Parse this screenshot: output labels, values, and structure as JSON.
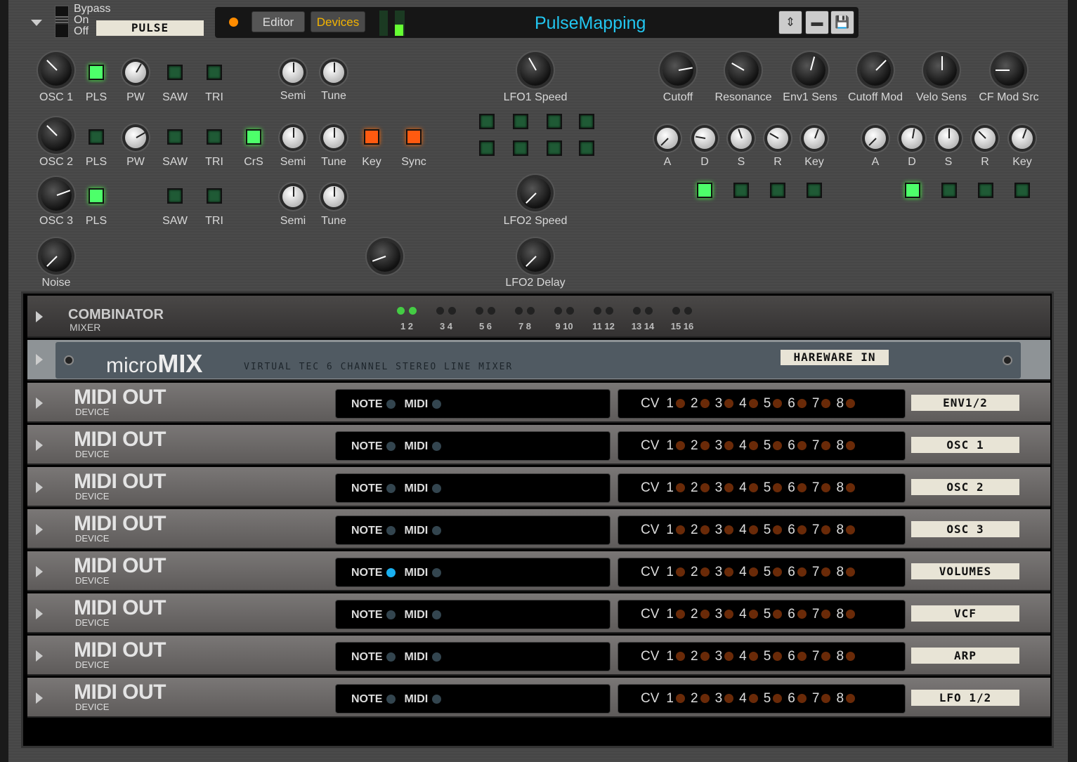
{
  "header": {
    "bypass": "Bypass",
    "on": "On",
    "off": "Off",
    "patch_name": "PULSE",
    "editor": "Editor",
    "devices": "Devices",
    "title": "PulseMapping"
  },
  "colors": {
    "accent_title": "#22c6f0",
    "devices_text": "#f4b400",
    "led_green": "#4dff6a",
    "led_orange": "#ff5a10"
  },
  "knobs": [
    {
      "label": "OSC 1",
      "style": "dark",
      "angle": -45
    },
    {
      "label": "PW",
      "style": "light",
      "angle": 30
    },
    {
      "label": "Semi",
      "style": "light",
      "angle": 0
    },
    {
      "label": "Tune",
      "style": "light",
      "angle": 0
    },
    {
      "label": "LFO1 Speed",
      "style": "dark",
      "angle": -30
    },
    {
      "label": "Cutoff",
      "style": "dark",
      "angle": 80
    },
    {
      "label": "Resonance",
      "style": "dark",
      "angle": -60
    },
    {
      "label": "Env1 Sens",
      "style": "dark",
      "angle": 15
    },
    {
      "label": "Cutoff Mod",
      "style": "dark",
      "angle": 45
    },
    {
      "label": "Velo Sens",
      "style": "dark",
      "angle": 0
    },
    {
      "label": "CF Mod Src",
      "style": "dark",
      "angle": -90
    },
    {
      "label": "OSC 2",
      "style": "dark",
      "angle": -45
    },
    {
      "label": "PW",
      "style": "light",
      "angle": 60
    },
    {
      "label": "Semi",
      "style": "light",
      "angle": 0
    },
    {
      "label": "Tune",
      "style": "light",
      "angle": 0
    },
    {
      "label": "A",
      "style": "light",
      "angle": -135
    },
    {
      "label": "D",
      "style": "light",
      "angle": -80
    },
    {
      "label": "S",
      "style": "light",
      "angle": -20
    },
    {
      "label": "R",
      "style": "light",
      "angle": -60
    },
    {
      "label": "Key",
      "style": "light",
      "angle": 20
    },
    {
      "label": "A",
      "style": "light",
      "angle": -135
    },
    {
      "label": "D",
      "style": "light",
      "angle": 10
    },
    {
      "label": "S",
      "style": "light",
      "angle": 0
    },
    {
      "label": "R",
      "style": "light",
      "angle": -45
    },
    {
      "label": "Key",
      "style": "light",
      "angle": 20
    },
    {
      "label": "OSC 3",
      "style": "dark",
      "angle": 70
    },
    {
      "label": "Semi",
      "style": "light",
      "angle": 0
    },
    {
      "label": "Tune",
      "style": "light",
      "angle": 0
    },
    {
      "label": "LFO2 Speed",
      "style": "dark",
      "angle": -135
    },
    {
      "label": "Noise",
      "style": "dark",
      "angle": -135
    },
    {
      "label": "",
      "style": "dark",
      "angle": -110
    },
    {
      "label": "LFO2 Delay",
      "style": "dark",
      "angle": -135
    }
  ],
  "buttons": [
    {
      "label": "PLS",
      "state": "on"
    },
    {
      "label": "SAW",
      "state": "off"
    },
    {
      "label": "TRI",
      "state": "off"
    },
    {
      "label": "PLS",
      "state": "off"
    },
    {
      "label": "SAW",
      "state": "off"
    },
    {
      "label": "TRI",
      "state": "off"
    },
    {
      "label": "CrS",
      "state": "on"
    },
    {
      "label": "Key",
      "state": "orange"
    },
    {
      "label": "Sync",
      "state": "orange"
    },
    {
      "label": "PLS",
      "state": "on"
    },
    {
      "label": "SAW",
      "state": "off"
    },
    {
      "label": "TRI",
      "state": "off"
    },
    {
      "label": "",
      "state": "off"
    },
    {
      "label": "",
      "state": "off"
    },
    {
      "label": "",
      "state": "off"
    },
    {
      "label": "",
      "state": "off"
    },
    {
      "label": "",
      "state": "off"
    },
    {
      "label": "",
      "state": "off"
    },
    {
      "label": "",
      "state": "off"
    },
    {
      "label": "",
      "state": "off"
    },
    {
      "label": "",
      "state": "on"
    },
    {
      "label": "",
      "state": "off"
    },
    {
      "label": "",
      "state": "off"
    },
    {
      "label": "",
      "state": "off"
    },
    {
      "label": "",
      "state": "on"
    },
    {
      "label": "",
      "state": "off"
    },
    {
      "label": "",
      "state": "off"
    },
    {
      "label": "",
      "state": "off"
    }
  ],
  "combinator": {
    "title": "COMBINATOR",
    "subtitle": "MIXER",
    "channels": [
      "1 2",
      "3 4",
      "5 6",
      "7 8",
      "9 10",
      "11 12",
      "13 14",
      "15 16"
    ],
    "active_channels": 1
  },
  "micromix": {
    "logo_light": "micro",
    "logo_bold": "MIX",
    "subtitle": "VIRTUAL TEC 6 CHANNEL STEREO LINE MIXER",
    "tape": "HAREWARE IN"
  },
  "midi_out": {
    "title": "MIDI OUT",
    "subtitle": "DEVICE",
    "note": "NOTE",
    "midi": "MIDI",
    "cv": "CV",
    "cv_numbers": [
      "1",
      "2",
      "3",
      "4",
      "5",
      "6",
      "7",
      "8"
    ],
    "rows": [
      {
        "tape": "ENV1/2",
        "note_active": false
      },
      {
        "tape": "OSC 1",
        "note_active": false
      },
      {
        "tape": "OSC 2",
        "note_active": false
      },
      {
        "tape": "OSC 3",
        "note_active": false
      },
      {
        "tape": "VOLUMES",
        "note_active": true
      },
      {
        "tape": "VCF",
        "note_active": false
      },
      {
        "tape": "ARP",
        "note_active": false
      },
      {
        "tape": "LFO 1/2",
        "note_active": false
      }
    ]
  }
}
